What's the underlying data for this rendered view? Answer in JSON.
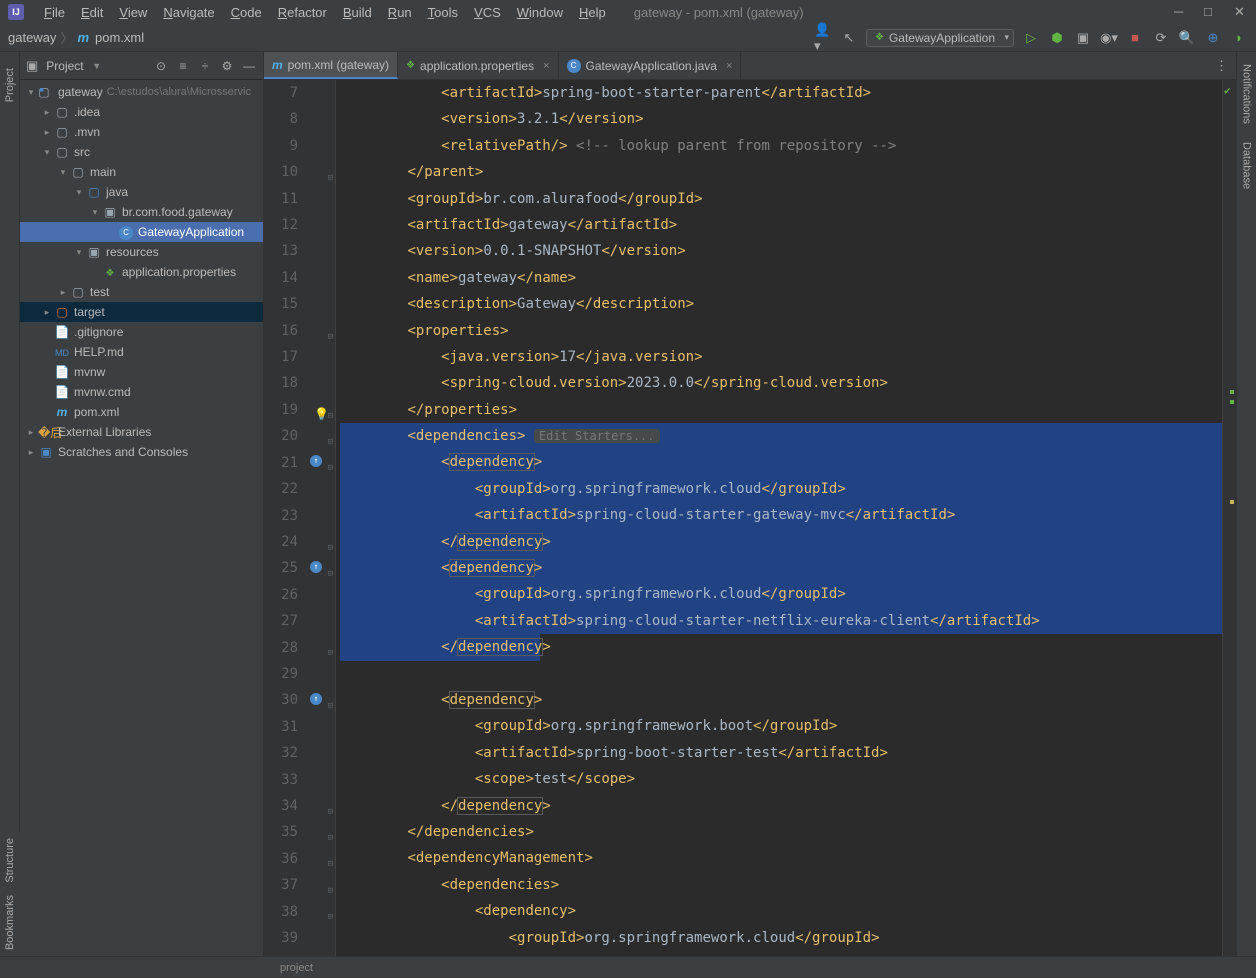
{
  "menu": [
    "File",
    "Edit",
    "View",
    "Navigate",
    "Code",
    "Refactor",
    "Build",
    "Run",
    "Tools",
    "VCS",
    "Window",
    "Help"
  ],
  "app_title": "gateway - pom.xml (gateway)",
  "breadcrumb": {
    "root": "gateway",
    "file": "pom.xml"
  },
  "run_config": "GatewayApplication",
  "project_panel": {
    "title": "Project"
  },
  "tree": {
    "root_name": "gateway",
    "root_path": "C:\\estudos\\alura\\Microsservic",
    "idea": ".idea",
    "mvn": ".mvn",
    "src": "src",
    "main": "main",
    "java": "java",
    "pkg": "br.com.food.gateway",
    "app_class": "GatewayApplication",
    "resources": "resources",
    "app_props": "application.properties",
    "test": "test",
    "target": "target",
    "gitignore": ".gitignore",
    "help_md": "HELP.md",
    "mvnw": "mvnw",
    "mvnw_cmd": "mvnw.cmd",
    "pom": "pom.xml",
    "ext_libs": "External Libraries",
    "scratches": "Scratches and Consoles"
  },
  "tabs": [
    {
      "label": "pom.xml (gateway)",
      "icon": "maven",
      "active": true,
      "close": false
    },
    {
      "label": "application.properties",
      "icon": "leaf",
      "active": false,
      "close": true
    },
    {
      "label": "GatewayApplication.java",
      "icon": "class",
      "active": false,
      "close": true
    }
  ],
  "hint": "Edit Starters...",
  "code_lines": {
    "l7": {
      "indent": 12,
      "parts": [
        [
          "tag",
          "<"
        ],
        [
          "tag",
          "artifactId"
        ],
        [
          "tag",
          ">"
        ],
        [
          "str",
          "spring-boot-starter-parent"
        ],
        [
          "tag",
          "</"
        ],
        [
          "tag",
          "artifactId"
        ],
        [
          "tag",
          ">"
        ]
      ]
    },
    "l8": {
      "indent": 12,
      "parts": [
        [
          "tag",
          "<"
        ],
        [
          "tag",
          "version"
        ],
        [
          "tag",
          ">"
        ],
        [
          "str",
          "3.2.1"
        ],
        [
          "tag",
          "</"
        ],
        [
          "tag",
          "version"
        ],
        [
          "tag",
          ">"
        ]
      ]
    },
    "l9": {
      "indent": 12,
      "parts": [
        [
          "tag",
          "<"
        ],
        [
          "tag",
          "relativePath"
        ],
        [
          "selfclose",
          "/>"
        ],
        [
          "str",
          " "
        ],
        [
          "comment",
          "<!-- lookup parent from repository -->"
        ]
      ]
    },
    "l10": {
      "indent": 8,
      "parts": [
        [
          "tag",
          "</"
        ],
        [
          "tag",
          "parent"
        ],
        [
          "tag",
          ">"
        ]
      ]
    },
    "l11": {
      "indent": 8,
      "parts": [
        [
          "tag",
          "<"
        ],
        [
          "tag",
          "groupId"
        ],
        [
          "tag",
          ">"
        ],
        [
          "str",
          "br.com.alurafood"
        ],
        [
          "tag",
          "</"
        ],
        [
          "tag",
          "groupId"
        ],
        [
          "tag",
          ">"
        ]
      ]
    },
    "l12": {
      "indent": 8,
      "parts": [
        [
          "tag",
          "<"
        ],
        [
          "tag",
          "artifactId"
        ],
        [
          "tag",
          ">"
        ],
        [
          "str",
          "gateway"
        ],
        [
          "tag",
          "</"
        ],
        [
          "tag",
          "artifactId"
        ],
        [
          "tag",
          ">"
        ]
      ]
    },
    "l13": {
      "indent": 8,
      "parts": [
        [
          "tag",
          "<"
        ],
        [
          "tag",
          "version"
        ],
        [
          "tag",
          ">"
        ],
        [
          "str",
          "0.0.1-SNAPSHOT"
        ],
        [
          "tag",
          "</"
        ],
        [
          "tag",
          "version"
        ],
        [
          "tag",
          ">"
        ]
      ]
    },
    "l14": {
      "indent": 8,
      "parts": [
        [
          "tag",
          "<"
        ],
        [
          "tag",
          "name"
        ],
        [
          "tag",
          ">"
        ],
        [
          "str",
          "gateway"
        ],
        [
          "tag",
          "</"
        ],
        [
          "tag",
          "name"
        ],
        [
          "tag",
          ">"
        ]
      ]
    },
    "l15": {
      "indent": 8,
      "parts": [
        [
          "tag",
          "<"
        ],
        [
          "tag",
          "description"
        ],
        [
          "tag",
          ">"
        ],
        [
          "str",
          "Gateway"
        ],
        [
          "tag",
          "</"
        ],
        [
          "tag",
          "description"
        ],
        [
          "tag",
          ">"
        ]
      ]
    },
    "l16": {
      "indent": 8,
      "parts": [
        [
          "tag",
          "<"
        ],
        [
          "tag",
          "properties"
        ],
        [
          "tag",
          ">"
        ]
      ]
    },
    "l17": {
      "indent": 12,
      "parts": [
        [
          "tag",
          "<"
        ],
        [
          "tag",
          "java.version"
        ],
        [
          "tag",
          ">"
        ],
        [
          "str",
          "17"
        ],
        [
          "tag",
          "</"
        ],
        [
          "tag",
          "java.version"
        ],
        [
          "tag",
          ">"
        ]
      ]
    },
    "l18": {
      "indent": 12,
      "parts": [
        [
          "tag",
          "<"
        ],
        [
          "tag",
          "spring-cloud.version"
        ],
        [
          "tag",
          ">"
        ],
        [
          "str",
          "2023.0.0"
        ],
        [
          "tag",
          "</"
        ],
        [
          "tag",
          "spring-cloud.version"
        ],
        [
          "tag",
          ">"
        ]
      ]
    },
    "l19": {
      "indent": 8,
      "parts": [
        [
          "tag",
          "</"
        ],
        [
          "tag",
          "properties"
        ],
        [
          "tag",
          ">"
        ]
      ]
    },
    "l20": {
      "indent": 8,
      "parts": [
        [
          "tag",
          "<"
        ],
        [
          "tag",
          "dependencies"
        ],
        [
          "tag",
          ">"
        ]
      ],
      "hint": true,
      "sel": true
    },
    "l21": {
      "indent": 12,
      "parts": [
        [
          "tag",
          "<"
        ],
        [
          "hl",
          "dependency"
        ],
        [
          "tag",
          ">"
        ]
      ],
      "sel": true
    },
    "l22": {
      "indent": 16,
      "parts": [
        [
          "tag",
          "<"
        ],
        [
          "tag",
          "groupId"
        ],
        [
          "tag",
          ">"
        ],
        [
          "str",
          "org.springframework.cloud"
        ],
        [
          "tag",
          "</"
        ],
        [
          "tag",
          "groupId"
        ],
        [
          "tag",
          ">"
        ]
      ],
      "sel": true
    },
    "l23": {
      "indent": 16,
      "parts": [
        [
          "tag",
          "<"
        ],
        [
          "tag",
          "artifactId"
        ],
        [
          "tag",
          ">"
        ],
        [
          "str",
          "spring-cloud-starter-gateway-mvc"
        ],
        [
          "tag",
          "</"
        ],
        [
          "tag",
          "artifactId"
        ],
        [
          "tag",
          ">"
        ]
      ],
      "sel": true
    },
    "l24": {
      "indent": 12,
      "parts": [
        [
          "tag",
          "</"
        ],
        [
          "hl",
          "dependency"
        ],
        [
          "tag",
          ">"
        ]
      ],
      "sel": true
    },
    "l25": {
      "indent": 12,
      "parts": [
        [
          "tag",
          "<"
        ],
        [
          "hl",
          "dependency"
        ],
        [
          "tag",
          ">"
        ]
      ],
      "sel": true
    },
    "l26": {
      "indent": 16,
      "parts": [
        [
          "tag",
          "<"
        ],
        [
          "tag",
          "groupId"
        ],
        [
          "tag",
          ">"
        ],
        [
          "str",
          "org.springframework.cloud"
        ],
        [
          "tag",
          "</"
        ],
        [
          "tag",
          "groupId"
        ],
        [
          "tag",
          ">"
        ]
      ],
      "sel": true
    },
    "l27": {
      "indent": 16,
      "parts": [
        [
          "tag",
          "<"
        ],
        [
          "tag",
          "artifactId"
        ],
        [
          "tag",
          ">"
        ],
        [
          "str",
          "spring-cloud-starter-netflix-eureka-client"
        ],
        [
          "tag",
          "</"
        ],
        [
          "tag",
          "artifactId"
        ],
        [
          "tag",
          ">"
        ]
      ],
      "sel": true
    },
    "l28": {
      "indent": 12,
      "parts": [
        [
          "tag",
          "</"
        ],
        [
          "hl",
          "dependency"
        ],
        [
          "tag",
          ">"
        ]
      ],
      "sel": true,
      "half": true
    },
    "l29": {
      "indent": 0,
      "parts": []
    },
    "l30": {
      "indent": 12,
      "parts": [
        [
          "tag",
          "<"
        ],
        [
          "hl",
          "dependency"
        ],
        [
          "tag",
          ">"
        ]
      ]
    },
    "l31": {
      "indent": 16,
      "parts": [
        [
          "tag",
          "<"
        ],
        [
          "tag",
          "groupId"
        ],
        [
          "tag",
          ">"
        ],
        [
          "str",
          "org.springframework.boot"
        ],
        [
          "tag",
          "</"
        ],
        [
          "tag",
          "groupId"
        ],
        [
          "tag",
          ">"
        ]
      ]
    },
    "l32": {
      "indent": 16,
      "parts": [
        [
          "tag",
          "<"
        ],
        [
          "tag",
          "artifactId"
        ],
        [
          "tag",
          ">"
        ],
        [
          "str",
          "spring-boot-starter-test"
        ],
        [
          "tag",
          "</"
        ],
        [
          "tag",
          "artifactId"
        ],
        [
          "tag",
          ">"
        ]
      ]
    },
    "l33": {
      "indent": 16,
      "parts": [
        [
          "tag",
          "<"
        ],
        [
          "tag",
          "scope"
        ],
        [
          "tag",
          ">"
        ],
        [
          "str",
          "test"
        ],
        [
          "tag",
          "</"
        ],
        [
          "tag",
          "scope"
        ],
        [
          "tag",
          ">"
        ]
      ]
    },
    "l34": {
      "indent": 12,
      "parts": [
        [
          "tag",
          "</"
        ],
        [
          "hl",
          "dependency"
        ],
        [
          "tag",
          ">"
        ]
      ]
    },
    "l35": {
      "indent": 8,
      "parts": [
        [
          "tag",
          "</"
        ],
        [
          "tag",
          "dependencies"
        ],
        [
          "tag",
          ">"
        ]
      ]
    },
    "l36": {
      "indent": 8,
      "parts": [
        [
          "tag",
          "<"
        ],
        [
          "tag",
          "dependencyManagement"
        ],
        [
          "tag",
          ">"
        ]
      ]
    },
    "l37": {
      "indent": 12,
      "parts": [
        [
          "tag",
          "<"
        ],
        [
          "tag",
          "dependencies"
        ],
        [
          "tag",
          ">"
        ]
      ]
    },
    "l38": {
      "indent": 16,
      "parts": [
        [
          "tag",
          "<"
        ],
        [
          "tag",
          "dependency"
        ],
        [
          "tag",
          ">"
        ]
      ]
    },
    "l39": {
      "indent": 20,
      "parts": [
        [
          "tag",
          "<"
        ],
        [
          "tag",
          "groupId"
        ],
        [
          "tag",
          ">"
        ],
        [
          "str",
          "org.springframework.cloud"
        ],
        [
          "tag",
          "</"
        ],
        [
          "tag",
          "groupId"
        ],
        [
          "tag",
          ">"
        ]
      ]
    }
  },
  "line_numbers": [
    7,
    8,
    9,
    10,
    11,
    12,
    13,
    14,
    15,
    16,
    17,
    18,
    19,
    20,
    21,
    22,
    23,
    24,
    25,
    26,
    27,
    28,
    29,
    30,
    31,
    32,
    33,
    34,
    35,
    36,
    37,
    38,
    39
  ],
  "gutter_icons": {
    "21": "circle",
    "25": "circle",
    "30": "circle",
    "19": "bulb"
  },
  "status_bar": {
    "tab": "project"
  },
  "left_rail": {
    "project": "Project"
  },
  "left_bottom": {
    "structure": "Structure",
    "bookmarks": "Bookmarks"
  },
  "right_rail": {
    "notifications": "Notifications",
    "database": "Database"
  }
}
